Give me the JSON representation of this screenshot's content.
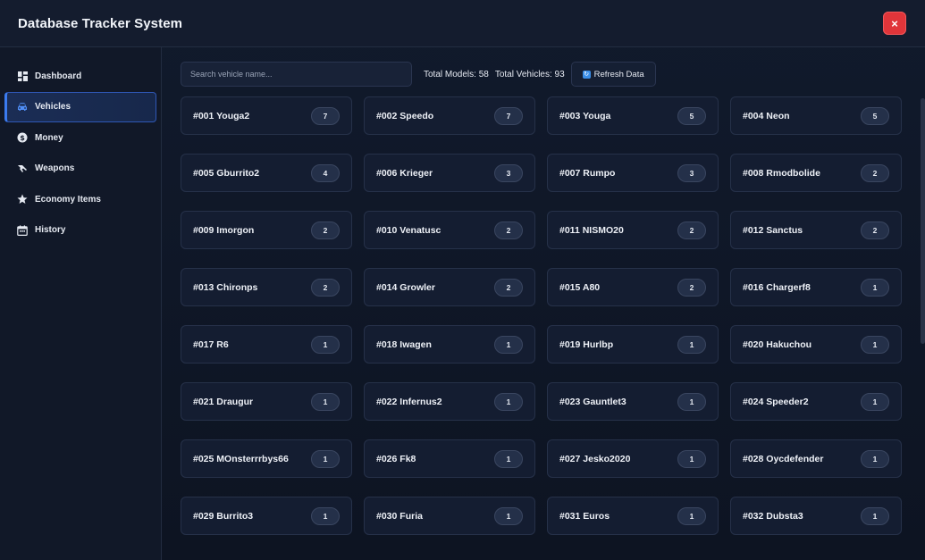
{
  "app": {
    "title": "Database Tracker System",
    "close_label": "×"
  },
  "sidebar": {
    "items": [
      {
        "label": "Dashboard",
        "icon": "dashboard-icon",
        "active": false
      },
      {
        "label": "Vehicles",
        "icon": "car-icon",
        "active": true
      },
      {
        "label": "Money",
        "icon": "dollar-icon",
        "active": false
      },
      {
        "label": "Weapons",
        "icon": "gun-icon",
        "active": false
      },
      {
        "label": "Economy Items",
        "icon": "star-icon",
        "active": false
      },
      {
        "label": "History",
        "icon": "calendar-icon",
        "active": false
      }
    ]
  },
  "toolbar": {
    "search_placeholder": "Search vehicle name...",
    "total_models": "Total Models: 58",
    "total_vehicles": "Total Vehicles: 93",
    "refresh_label": "Refresh Data"
  },
  "vehicles": [
    {
      "name": "#001 Youga2",
      "count": "7"
    },
    {
      "name": "#002 Speedo",
      "count": "7"
    },
    {
      "name": "#003 Youga",
      "count": "5"
    },
    {
      "name": "#004 Neon",
      "count": "5"
    },
    {
      "name": "#005 Gburrito2",
      "count": "4"
    },
    {
      "name": "#006 Krieger",
      "count": "3"
    },
    {
      "name": "#007 Rumpo",
      "count": "3"
    },
    {
      "name": "#008 Rmodbolide",
      "count": "2"
    },
    {
      "name": "#009 Imorgon",
      "count": "2"
    },
    {
      "name": "#010 Venatusc",
      "count": "2"
    },
    {
      "name": "#011 NISMO20",
      "count": "2"
    },
    {
      "name": "#012 Sanctus",
      "count": "2"
    },
    {
      "name": "#013 Chironps",
      "count": "2"
    },
    {
      "name": "#014 Growler",
      "count": "2"
    },
    {
      "name": "#015 A80",
      "count": "2"
    },
    {
      "name": "#016 Chargerf8",
      "count": "1"
    },
    {
      "name": "#017 R6",
      "count": "1"
    },
    {
      "name": "#018 Iwagen",
      "count": "1"
    },
    {
      "name": "#019 Hurlbp",
      "count": "1"
    },
    {
      "name": "#020 Hakuchou",
      "count": "1"
    },
    {
      "name": "#021 Draugur",
      "count": "1"
    },
    {
      "name": "#022 Infernus2",
      "count": "1"
    },
    {
      "name": "#023 Gauntlet3",
      "count": "1"
    },
    {
      "name": "#024 Speeder2",
      "count": "1"
    },
    {
      "name": "#025 MOnsterrrbys66",
      "count": "1"
    },
    {
      "name": "#026 Fk8",
      "count": "1"
    },
    {
      "name": "#027 Jesko2020",
      "count": "1"
    },
    {
      "name": "#028 Oycdefender",
      "count": "1"
    },
    {
      "name": "#029 Burrito3",
      "count": "1"
    },
    {
      "name": "#030 Furia",
      "count": "1"
    },
    {
      "name": "#031 Euros",
      "count": "1"
    },
    {
      "name": "#032 Dubsta3",
      "count": "1"
    }
  ],
  "colors": {
    "accent": "#3b7bf0",
    "close": "#e0353a",
    "background": "#0e1525"
  }
}
